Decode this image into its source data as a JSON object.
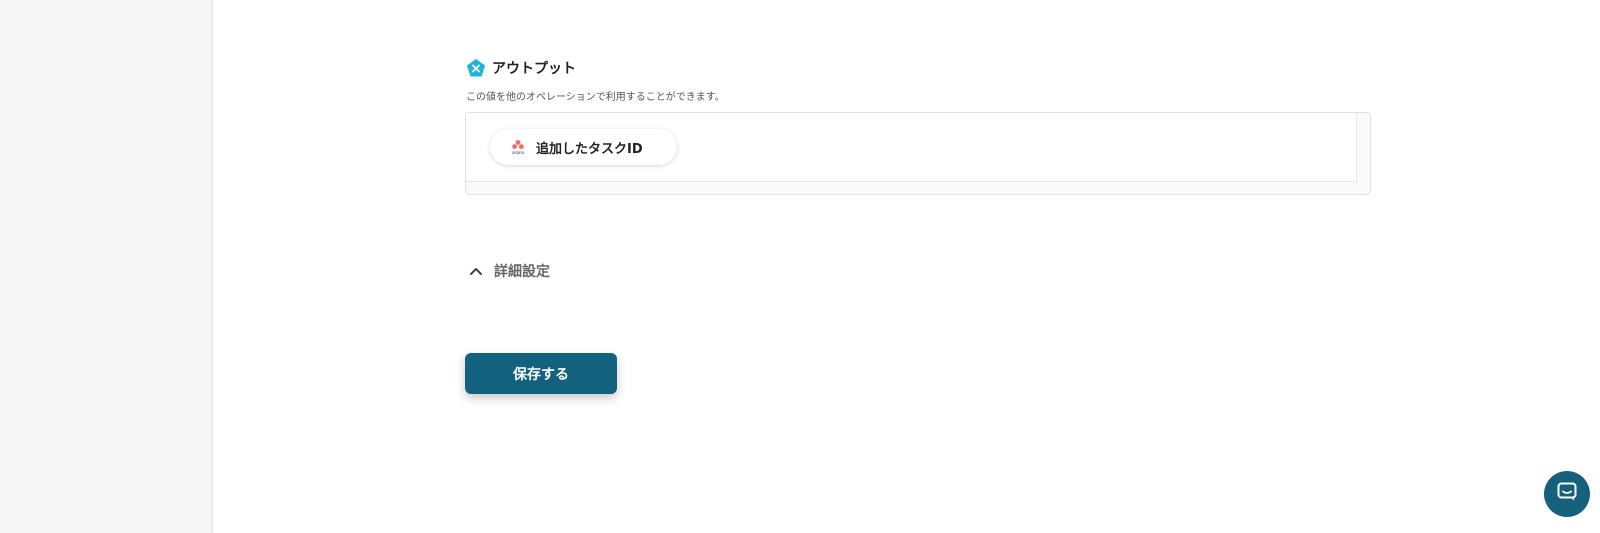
{
  "output": {
    "title": "アウトプット",
    "description": "この値を他のオペレーションで利用することができます。",
    "items": [
      {
        "label": "追加したタスクID",
        "icon": "asana-icon"
      }
    ]
  },
  "details": {
    "label": "詳細設定",
    "expanded": true
  },
  "actions": {
    "save_label": "保存する"
  },
  "chat": {
    "icon": "chat-icon"
  },
  "colors": {
    "primary": "#12617f",
    "output_icon": "#1bb5d8",
    "asana": "#f06a6a"
  }
}
